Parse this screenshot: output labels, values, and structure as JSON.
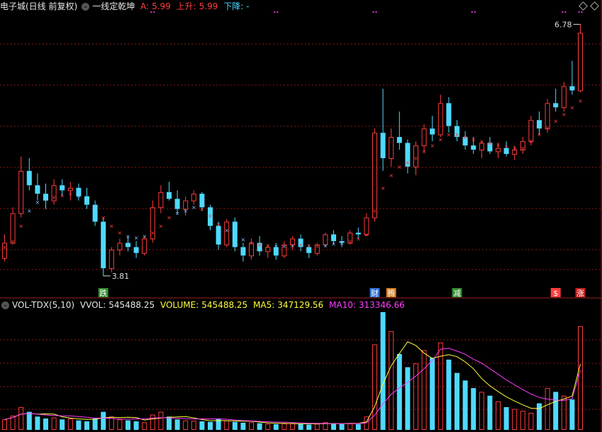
{
  "header": {
    "title": "电子城(日线 前复权)",
    "indicator_name": "一线定乾坤",
    "a_label": "A:",
    "a_value": "5.99",
    "up_label": "上升:",
    "up_value": "5.99",
    "down_label": "下降:",
    "down_value": "-"
  },
  "volume_header": {
    "indicator": "VOL-TDX(5,10)",
    "vvol_label": "VVOL:",
    "vvol_value": "545488.25",
    "volume_label": "VOLUME:",
    "volume_value": "545488.25",
    "ma5_label": "MA5:",
    "ma5_value": "347129.56",
    "ma10_label": "MA10:",
    "ma10_value": "313346.66"
  },
  "annotations": {
    "high_label": "6.78",
    "low_label": "3.81",
    "signals": [
      {
        "text": "跌",
        "index": 12,
        "color": "#2e8b2e"
      },
      {
        "text": "财",
        "index": 45,
        "color": "#2f6fd6"
      },
      {
        "text": "腾",
        "index": 47,
        "color": "#d07a1a"
      },
      {
        "text": "减",
        "index": 55,
        "color": "#2e8b2e"
      },
      {
        "text": "$",
        "index": 67,
        "color": "#ff3d3d"
      },
      {
        "text": "涨",
        "index": 70,
        "color": "#c02020"
      }
    ]
  },
  "colors": {
    "up": "#ff3d3d",
    "down": "#4fd9ff",
    "ma5": "#ffff3d",
    "ma10": "#ff3dff",
    "grid": "#8b1a1a"
  },
  "chart_data": [
    {
      "type": "candlestick",
      "title": "电子城(日线 前复权)",
      "ylim": [
        3.6,
        6.9
      ],
      "candles": [
        [
          4.02,
          4.3,
          3.98,
          4.2
        ],
        [
          4.2,
          4.62,
          4.18,
          4.55
        ],
        [
          4.55,
          5.22,
          4.5,
          5.05
        ],
        [
          5.05,
          5.2,
          4.82,
          4.88
        ],
        [
          4.88,
          5.02,
          4.7,
          4.78
        ],
        [
          4.78,
          4.9,
          4.6,
          4.7
        ],
        [
          4.7,
          4.95,
          4.65,
          4.88
        ],
        [
          4.88,
          4.95,
          4.75,
          4.82
        ],
        [
          4.82,
          4.92,
          4.7,
          4.85
        ],
        [
          4.85,
          4.9,
          4.7,
          4.75
        ],
        [
          4.75,
          4.85,
          4.6,
          4.65
        ],
        [
          4.65,
          4.7,
          4.4,
          4.45
        ],
        [
          4.45,
          4.5,
          3.81,
          3.9
        ],
        [
          3.9,
          4.15,
          3.85,
          4.12
        ],
        [
          4.12,
          4.25,
          4.05,
          4.2
        ],
        [
          4.2,
          4.28,
          4.1,
          4.15
        ],
        [
          4.15,
          4.22,
          4.02,
          4.08
        ],
        [
          4.08,
          4.28,
          4.05,
          4.25
        ],
        [
          4.25,
          4.7,
          4.2,
          4.62
        ],
        [
          4.62,
          4.88,
          4.55,
          4.8
        ],
        [
          4.8,
          4.92,
          4.7,
          4.72
        ],
        [
          4.72,
          4.82,
          4.55,
          4.6
        ],
        [
          4.6,
          4.75,
          4.52,
          4.7
        ],
        [
          4.7,
          4.82,
          4.65,
          4.78
        ],
        [
          4.78,
          4.8,
          4.58,
          4.62
        ],
        [
          4.62,
          4.65,
          4.35,
          4.4
        ],
        [
          4.4,
          4.45,
          4.12,
          4.18
        ],
        [
          4.18,
          4.48,
          4.15,
          4.45
        ],
        [
          4.45,
          4.5,
          4.1,
          4.15
        ],
        [
          4.15,
          4.2,
          3.98,
          4.05
        ],
        [
          4.05,
          4.25,
          4.0,
          4.2
        ],
        [
          4.2,
          4.28,
          4.05,
          4.1
        ],
        [
          4.1,
          4.18,
          4.02,
          4.15
        ],
        [
          4.15,
          4.2,
          4.0,
          4.05
        ],
        [
          4.05,
          4.22,
          4.02,
          4.18
        ],
        [
          4.18,
          4.28,
          4.12,
          4.25
        ],
        [
          4.25,
          4.3,
          4.1,
          4.15
        ],
        [
          4.15,
          4.18,
          4.02,
          4.08
        ],
        [
          4.08,
          4.2,
          4.05,
          4.18
        ],
        [
          4.18,
          4.32,
          4.15,
          4.3
        ],
        [
          4.3,
          4.35,
          4.18,
          4.22
        ],
        [
          4.22,
          4.28,
          4.15,
          4.2
        ],
        [
          4.2,
          4.35,
          4.18,
          4.32
        ],
        [
          4.32,
          4.38,
          4.25,
          4.3
        ],
        [
          4.3,
          4.55,
          4.28,
          4.5
        ],
        [
          4.5,
          5.55,
          4.45,
          5.5
        ],
        [
          5.5,
          6.02,
          5.05,
          5.2
        ],
        [
          5.2,
          5.55,
          5.1,
          5.45
        ],
        [
          5.45,
          5.75,
          5.3,
          5.38
        ],
        [
          5.38,
          5.42,
          5.02,
          5.1
        ],
        [
          5.1,
          5.4,
          5.0,
          5.35
        ],
        [
          5.35,
          5.6,
          5.28,
          5.55
        ],
        [
          5.55,
          5.7,
          5.4,
          5.48
        ],
        [
          5.48,
          5.95,
          5.45,
          5.85
        ],
        [
          5.85,
          5.92,
          5.5,
          5.58
        ],
        [
          5.58,
          5.65,
          5.4,
          5.45
        ],
        [
          5.45,
          5.52,
          5.3,
          5.35
        ],
        [
          5.35,
          5.45,
          5.25,
          5.3
        ],
        [
          5.3,
          5.4,
          5.2,
          5.38
        ],
        [
          5.38,
          5.45,
          5.25,
          5.28
        ],
        [
          5.28,
          5.38,
          5.2,
          5.32
        ],
        [
          5.32,
          5.4,
          5.22,
          5.25
        ],
        [
          5.25,
          5.35,
          5.18,
          5.3
        ],
        [
          5.3,
          5.45,
          5.25,
          5.4
        ],
        [
          5.4,
          5.7,
          5.35,
          5.65
        ],
        [
          5.65,
          5.75,
          5.48,
          5.55
        ],
        [
          5.55,
          5.9,
          5.5,
          5.85
        ],
        [
          5.85,
          6.02,
          5.75,
          5.8
        ],
        [
          5.8,
          6.1,
          5.75,
          6.05
        ],
        [
          6.05,
          6.35,
          5.95,
          6.0
        ],
        [
          6.0,
          6.78,
          5.98,
          6.68
        ]
      ],
      "line_A": [
        4.15,
        4.22,
        4.4,
        4.58,
        4.68,
        4.72,
        4.74,
        4.76,
        4.78,
        4.76,
        4.72,
        4.62,
        4.5,
        4.4,
        4.32,
        4.28,
        4.26,
        4.28,
        4.32,
        4.4,
        4.5,
        4.55,
        4.58,
        4.62,
        4.6,
        4.52,
        4.42,
        4.35,
        4.3,
        4.24,
        4.2,
        4.18,
        4.17,
        4.16,
        4.16,
        4.17,
        4.18,
        4.17,
        4.16,
        4.17,
        4.19,
        4.2,
        4.22,
        4.25,
        4.3,
        4.58,
        4.85,
        5.0,
        5.1,
        5.15,
        5.2,
        5.28,
        5.35,
        5.42,
        5.48,
        5.48,
        5.45,
        5.42,
        5.4,
        5.38,
        5.36,
        5.34,
        5.32,
        5.32,
        5.4,
        5.48,
        5.56,
        5.64,
        5.72,
        5.8,
        5.88
      ]
    },
    {
      "type": "bar",
      "title": "VOL-TDX(5,10)",
      "ylim": [
        0,
        620000
      ],
      "series": [
        {
          "name": "VOLUME",
          "values": [
            55000,
            75000,
            120000,
            95000,
            70000,
            60000,
            65000,
            55000,
            60000,
            50000,
            45000,
            60000,
            95000,
            70000,
            55000,
            50000,
            45000,
            40000,
            80000,
            95000,
            70000,
            55000,
            50000,
            48000,
            45000,
            42000,
            60000,
            50000,
            42000,
            38000,
            40000,
            35000,
            32000,
            30000,
            34000,
            36000,
            30000,
            28000,
            32000,
            40000,
            35000,
            30000,
            34000,
            30000,
            70000,
            450000,
            620000,
            520000,
            400000,
            330000,
            350000,
            420000,
            380000,
            460000,
            370000,
            300000,
            260000,
            220000,
            200000,
            180000,
            150000,
            120000,
            110000,
            100000,
            90000,
            140000,
            220000,
            200000,
            180000,
            160000,
            545488.25
          ]
        },
        {
          "name": "MA5",
          "values": [
            55000,
            65000,
            83000,
            86000,
            83000,
            84000,
            83000,
            69000,
            62000,
            58000,
            55000,
            56000,
            63000,
            66000,
            65000,
            66000,
            65000,
            52000,
            58000,
            62000,
            66000,
            68000,
            70000,
            63000,
            54000,
            48000,
            49000,
            48000,
            47000,
            46000,
            46000,
            41000,
            37000,
            35000,
            34000,
            33000,
            32000,
            32000,
            32000,
            33000,
            33000,
            33000,
            34000,
            34000,
            42000,
            124000,
            241000,
            338000,
            402000,
            464000,
            444000,
            404000,
            376000,
            388000,
            396000,
            386000,
            358000,
            322000,
            270000,
            232000,
            202000,
            174000,
            152000,
            132000,
            114000,
            112000,
            132000,
            150000,
            162000,
            178000,
            347129.56
          ]
        },
        {
          "name": "MA10",
          "values": [
            55000,
            65000,
            83000,
            86000,
            83000,
            78000,
            76000,
            74000,
            74000,
            70000,
            66000,
            62000,
            62000,
            60000,
            57000,
            56000,
            58000,
            58000,
            62000,
            64000,
            63000,
            61000,
            59000,
            57000,
            58000,
            58000,
            58000,
            56000,
            52000,
            49000,
            47000,
            45000,
            43000,
            41000,
            40000,
            39000,
            37000,
            35000,
            34000,
            34000,
            33000,
            33000,
            33000,
            33000,
            37000,
            78000,
            137000,
            187000,
            221000,
            251000,
            283000,
            322000,
            366000,
            425000,
            430000,
            415000,
            398000,
            372000,
            352000,
            322000,
            293000,
            263000,
            237000,
            212000,
            189000,
            171000,
            162000,
            157000,
            155000,
            164000,
            313346.66
          ]
        }
      ]
    }
  ]
}
